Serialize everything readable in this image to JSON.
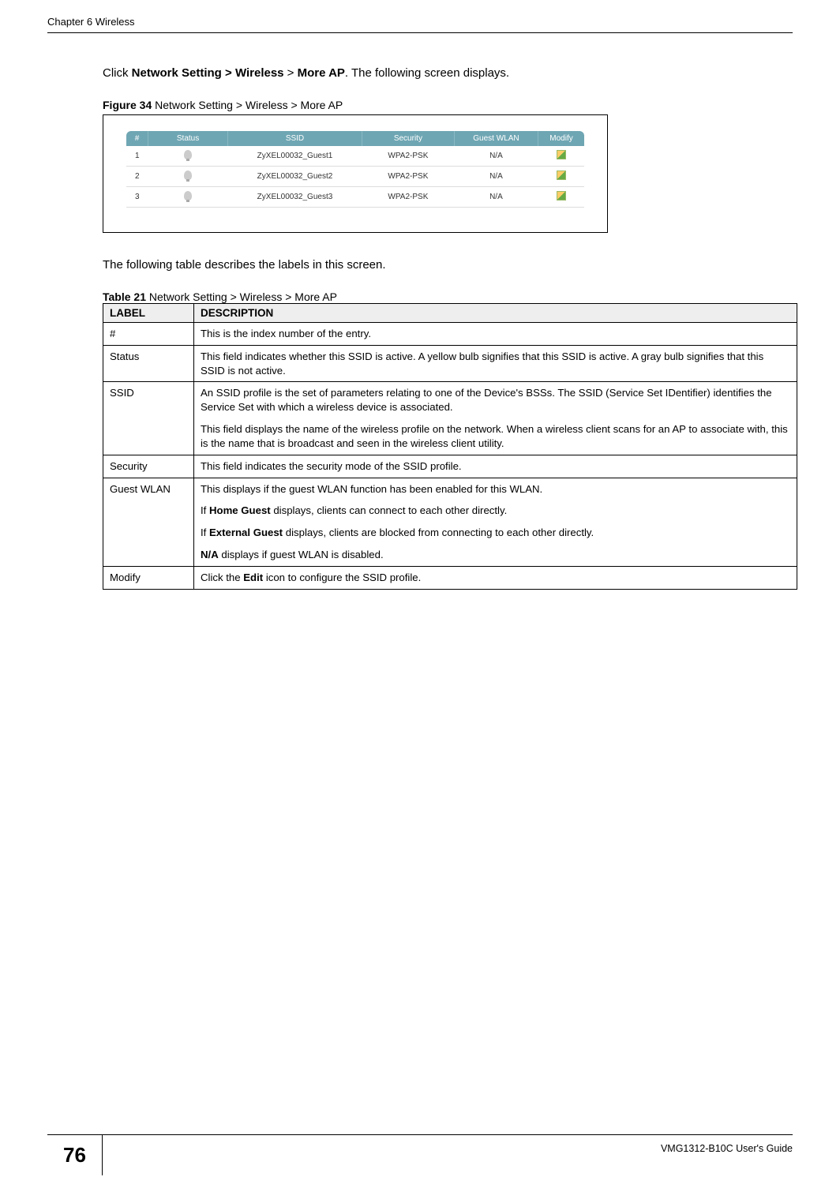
{
  "header": {
    "chapter": "Chapter 6 Wireless"
  },
  "intro": {
    "prefix": "Click ",
    "b1": "Network Setting > Wireless",
    "mid": " > ",
    "b2": "More AP",
    "suffix": ". The following screen displays."
  },
  "figure": {
    "label": "Figure 34",
    "caption": "   Network Setting > Wireless > More AP",
    "columns": {
      "c1": "#",
      "c2": "Status",
      "c3": "SSID",
      "c4": "Security",
      "c5": "Guest WLAN",
      "c6": "Modify"
    },
    "rows": [
      {
        "n": "1",
        "ssid": "ZyXEL00032_Guest1",
        "sec": "WPA2-PSK",
        "gw": "N/A"
      },
      {
        "n": "2",
        "ssid": "ZyXEL00032_Guest2",
        "sec": "WPA2-PSK",
        "gw": "N/A"
      },
      {
        "n": "3",
        "ssid": "ZyXEL00032_Guest3",
        "sec": "WPA2-PSK",
        "gw": "N/A"
      }
    ]
  },
  "table_intro": "The following table describes the labels in this screen.",
  "table": {
    "label": "Table 21",
    "caption": "   Network Setting > Wireless > More AP",
    "head": {
      "c1": "LABEL",
      "c2": "DESCRIPTION"
    },
    "rows": {
      "r1": {
        "label": "#",
        "desc": "This is the index number of the entry."
      },
      "r2": {
        "label": "Status",
        "desc": "This field indicates whether this SSID is active. A yellow bulb signifies that this SSID is active. A gray bulb signifies that this SSID is not active."
      },
      "r3": {
        "label": "SSID",
        "p1": "An SSID profile is the set of parameters relating to one of the Device's BSSs. The SSID (Service Set IDentifier) identifies the Service Set with which a wireless device is associated.",
        "p2": "This field displays the name of the wireless profile on the network. When a wireless client scans for an AP to associate with, this is the name that is broadcast and seen in the wireless client utility."
      },
      "r4": {
        "label": "Security",
        "desc": "This field indicates the security mode of the SSID profile."
      },
      "r5": {
        "label": "Guest WLAN",
        "p1": "This displays if the guest WLAN function has been enabled for this WLAN.",
        "p2a": "If ",
        "p2b": "Home Guest",
        "p2c": " displays, clients can connect to each other directly.",
        "p3a": "If ",
        "p3b": "External Guest",
        "p3c": " displays, clients are blocked from connecting to each other directly.",
        "p4a": "N/A",
        "p4b": " displays if guest WLAN is disabled."
      },
      "r6": {
        "label": "Modify",
        "d1": "Click the ",
        "d2": "Edit",
        "d3": " icon to configure the SSID profile."
      }
    }
  },
  "footer": {
    "page": "76",
    "guide": "VMG1312-B10C User's Guide"
  }
}
